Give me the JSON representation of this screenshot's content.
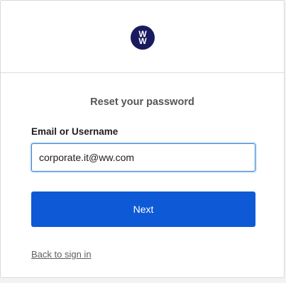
{
  "logo": {
    "line1": "W",
    "line2": "W",
    "color": "#1a1a5e"
  },
  "form": {
    "title": "Reset your password",
    "field_label": "Email or Username",
    "email_value": "corporate.it@ww.com",
    "submit_label": "Next",
    "back_link_label": "Back to sign in"
  },
  "colors": {
    "primary_button": "#0e5ad6",
    "input_focus_border": "#2f7fd1"
  }
}
